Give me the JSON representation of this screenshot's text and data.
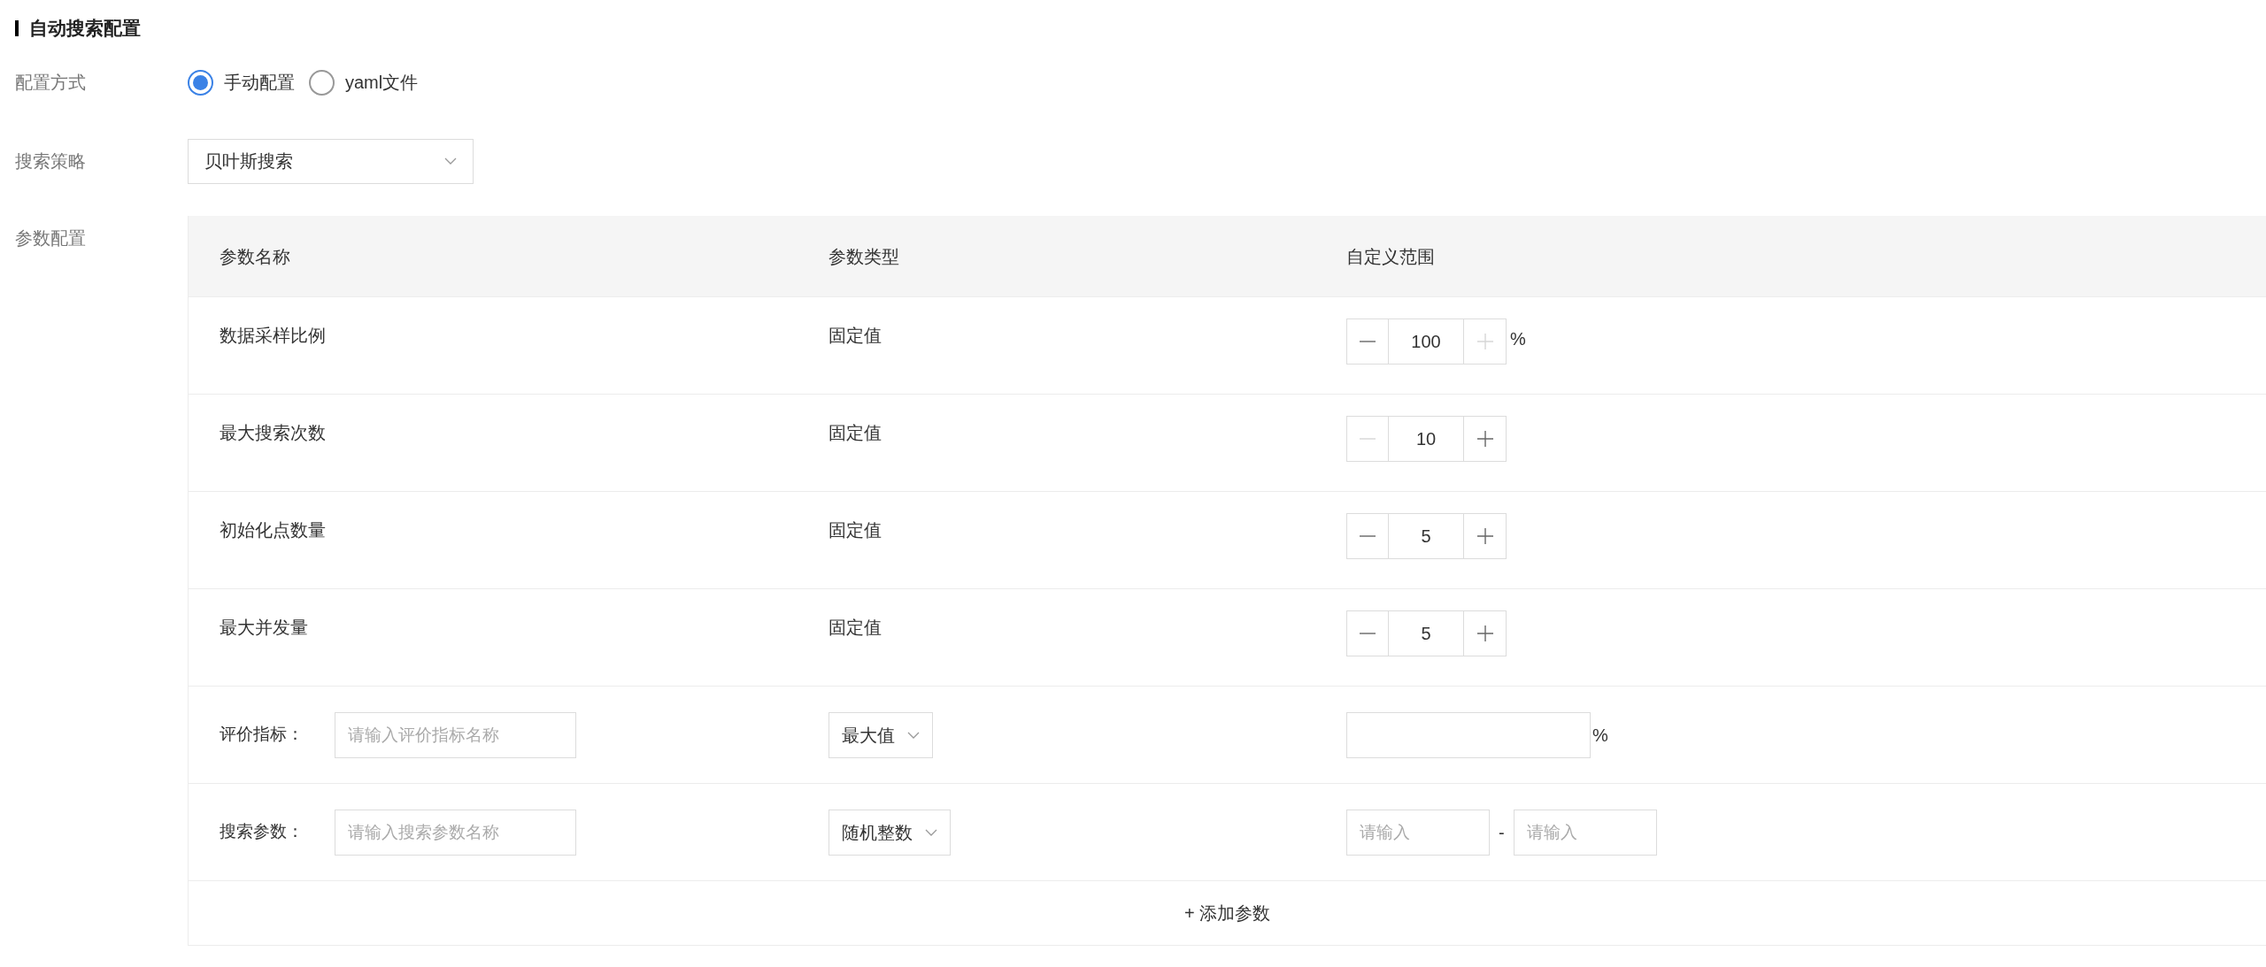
{
  "section_title": "自动搜索配置",
  "config_mode": {
    "label": "配置方式",
    "options": [
      {
        "label": "手动配置",
        "selected": true
      },
      {
        "label": "yaml文件",
        "selected": false
      }
    ]
  },
  "search_strategy": {
    "label": "搜索策略",
    "value": "贝叶斯搜索"
  },
  "param_config": {
    "label": "参数配置",
    "table": {
      "columns": [
        "参数名称",
        "参数类型",
        "自定义范围"
      ],
      "rows": [
        {
          "kind": "stepper",
          "name": "数据采样比例",
          "type": "固定值",
          "value": "100",
          "unit": "%",
          "minus_disabled": false,
          "plus_disabled": true
        },
        {
          "kind": "stepper",
          "name": "最大搜索次数",
          "type": "固定值",
          "value": "10",
          "minus_disabled": true,
          "plus_disabled": false
        },
        {
          "kind": "stepper",
          "name": "初始化点数量",
          "type": "固定值",
          "value": "5",
          "minus_disabled": false,
          "plus_disabled": false
        },
        {
          "kind": "stepper",
          "name": "最大并发量",
          "type": "固定值",
          "value": "5",
          "minus_disabled": false,
          "plus_disabled": false
        },
        {
          "kind": "metric",
          "label": "评价指标：",
          "placeholder": "请输入评价指标名称",
          "select": "最大值",
          "unit": "%"
        },
        {
          "kind": "range",
          "label": "搜索参数：",
          "placeholder": "请输入搜索参数名称",
          "select": "随机整数",
          "min_placeholder": "请输入",
          "separator": "-",
          "max_placeholder": "请输入"
        }
      ],
      "add_button": "+ 添加参数"
    }
  }
}
